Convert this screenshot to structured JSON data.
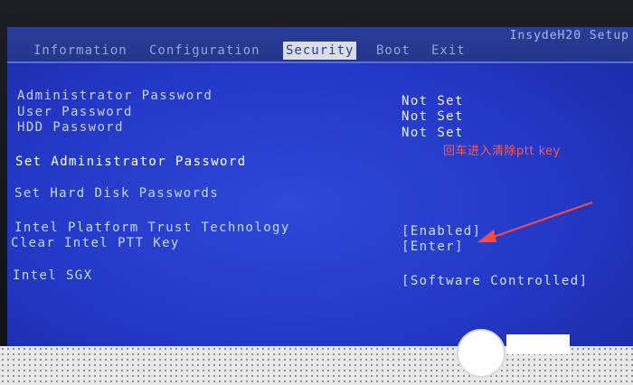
{
  "bios": {
    "vendor": "InsydeH20 Setup",
    "tabs": [
      {
        "label": "Information"
      },
      {
        "label": "Configuration"
      },
      {
        "label": "Security"
      },
      {
        "label": "Boot"
      },
      {
        "label": "Exit"
      }
    ],
    "active_tab_index": 2
  },
  "items": {
    "admin_password_label": "Administrator Password",
    "admin_password_value": "Not Set",
    "user_password_label": "User Password",
    "user_password_value": "Not Set",
    "hdd_password_label": "HDD Password",
    "hdd_password_value": "Not Set",
    "set_admin_password": "Set Administrator Password",
    "set_hdd_passwords": "Set Hard Disk Passwords",
    "ptt_label": "Intel Platform Trust Technology",
    "ptt_value": "[Enabled]",
    "clear_ptt_label": "Clear Intel PTT Key",
    "clear_ptt_value": "[Enter]",
    "sgx_label": "Intel SGX",
    "sgx_value": "[Software Controlled]"
  },
  "annotation": {
    "text": "回车进入清除ptt key",
    "color": "#ff5a4d"
  },
  "colors": {
    "screen_blue": "#2338c6",
    "text_dim": "#c9d0f0",
    "text_bright": "#ffffff"
  }
}
